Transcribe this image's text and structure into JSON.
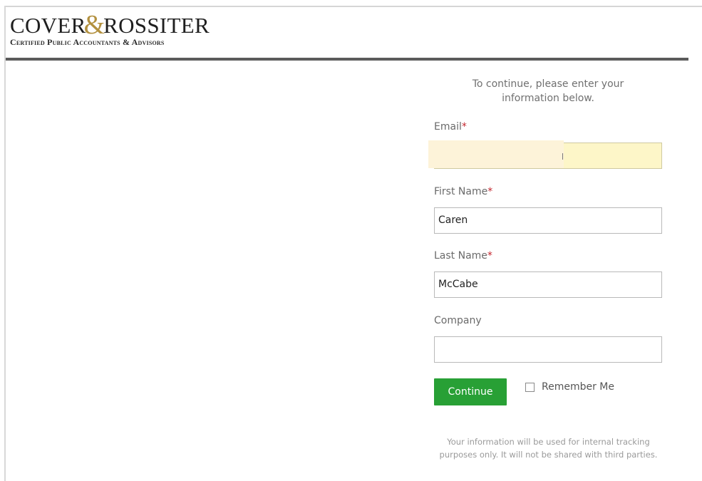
{
  "header": {
    "logo_left": "COVER",
    "logo_amp": "&",
    "logo_right": "ROSSITER",
    "logo_tagline": "Certified Public Accountants & Advisors"
  },
  "form": {
    "intro_text": "To continue, please enter your information below.",
    "required_marker": "*",
    "fields": [
      {
        "label": "Email",
        "required": true,
        "value": ""
      },
      {
        "label": "First Name",
        "required": true,
        "value": "Caren"
      },
      {
        "label": "Last Name",
        "required": true,
        "value": "McCabe"
      },
      {
        "label": "Company",
        "required": false,
        "value": ""
      }
    ],
    "continue_label": "Continue",
    "remember_label": "Remember Me",
    "remember_checked": false,
    "privacy_note": "Your information will be used for internal tracking purposes only. It will not be shared with third parties."
  },
  "colors": {
    "accent_green": "#28a035",
    "logo_gold": "#b3913f",
    "required_red": "#c4262e",
    "autofill_yellow": "#fdf6c8"
  }
}
